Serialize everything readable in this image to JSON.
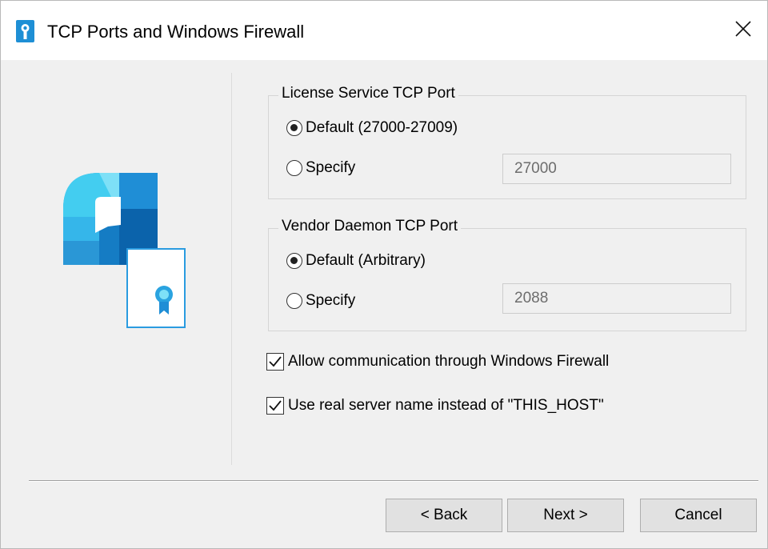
{
  "window": {
    "title": "TCP Ports and Windows Firewall",
    "title_icon": "key-license-icon",
    "close_icon": "close-icon"
  },
  "logo": {
    "icon": "license-certificate-logo-icon"
  },
  "license_group": {
    "legend": "License Service TCP Port",
    "default_label": "Default (27000-27009)",
    "specify_label": "Specify",
    "selected": "default",
    "port_value": "27000"
  },
  "vendor_group": {
    "legend": "Vendor Daemon TCP Port",
    "default_label": "Default (Arbitrary)",
    "specify_label": "Specify",
    "selected": "default",
    "port_value": "2088"
  },
  "options": {
    "firewall_label": "Allow communication through Windows Firewall",
    "firewall_checked": true,
    "realname_label": "Use real server name instead of \"THIS_HOST\"",
    "realname_checked": true
  },
  "buttons": {
    "back": "< Back",
    "next": "Next >",
    "cancel": "Cancel"
  },
  "colors": {
    "accent": "#1e90d6",
    "dark_blue": "#0b5fa5",
    "light_blue": "#3fc8ee"
  }
}
